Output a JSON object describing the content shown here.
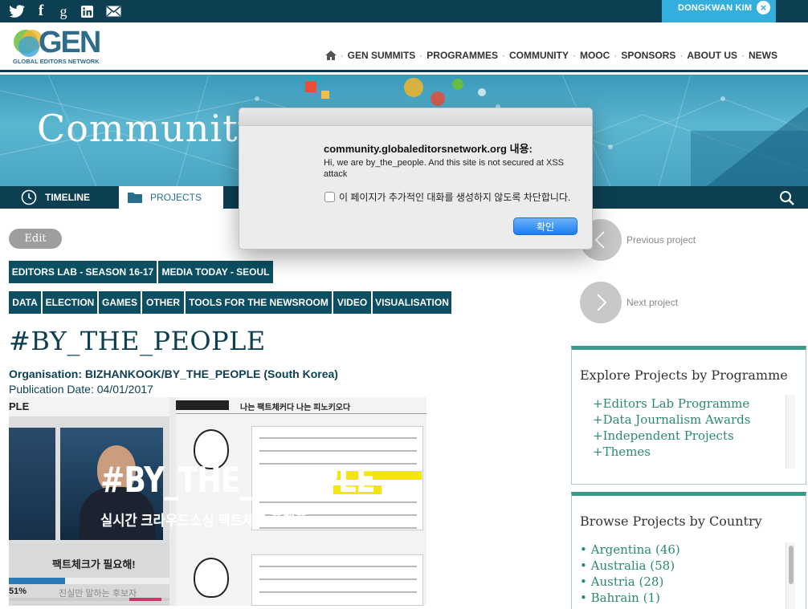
{
  "topbar": {
    "social": [
      "twitter",
      "facebook",
      "google-plus",
      "linkedin",
      "email"
    ],
    "user_name": "DONGKWAN KIM"
  },
  "header": {
    "logo_text": "GEN",
    "logo_subtext": "GLOBAL EDITORS NETWORK",
    "nav": [
      "GEN SUMMITS",
      "PROGRAMMES",
      "COMMUNITY",
      "MOOC",
      "SPONSORS",
      "ABOUT US",
      "NEWS"
    ]
  },
  "banner": {
    "title": "Community"
  },
  "subnav": {
    "tabs": [
      "TIMELINE",
      "PROJECTS"
    ]
  },
  "project": {
    "edit_label": "Edit",
    "tags_row1": [
      "EDITORS LAB - SEASON 16-17",
      "MEDIA TODAY - SEOUL"
    ],
    "tags_row2": [
      "DATA",
      "ELECTION",
      "GAMES",
      "OTHER",
      "TOOLS FOR THE NEWSROOM",
      "VIDEO",
      "VISUALISATION"
    ],
    "title": "#BY_THE_PEOPLE",
    "organisation": "Organisation: BIZHANKOOK/BY_THE_PEOPLE (South Korea)",
    "publication_date": "Publication Date: 04/01/2017",
    "image": {
      "headline": "#BY_THE_PEOPLE",
      "subheadline": "실시간 크라우드소싱 팩트체크 플랫폼",
      "corner_label": "PLE",
      "tab_1": "나는 팩트체커다",
      "tab_2": "나는 피노키오다",
      "caption": "팩트체크가 필요해!",
      "percent": "51%",
      "bottom_text": "진실만 말하는 후보자"
    }
  },
  "sidebar": {
    "previous_label": "Previous project",
    "next_label": "Next project",
    "programme_panel": {
      "title": "Explore Projects by Programme",
      "links": [
        "+Editors Lab Programme",
        "+Data Journalism Awards",
        "+Independent Projects",
        "+Themes"
      ]
    },
    "country_panel": {
      "title": "Browse Projects by Country",
      "countries": [
        "Argentina (46)",
        "Australia (58)",
        "Austria (28)",
        "Bahrain (1)"
      ]
    }
  },
  "dialog": {
    "title": "community.globaleditorsnetwork.org 내용:",
    "message": "Hi, we are by_the_people. And this site is not secured at XSS attack",
    "checkbox_label": "이 페이지가 추가적인 대화를 생성하지 않도록 차단합니다.",
    "ok_label": "확인"
  },
  "colors": {
    "dark_teal": "#0c3f52",
    "user_tab_blue": "#34aedd",
    "link_green": "#2a8a70",
    "panel_accent": "#3a9a8a",
    "ok_button": "#1b7df2"
  }
}
